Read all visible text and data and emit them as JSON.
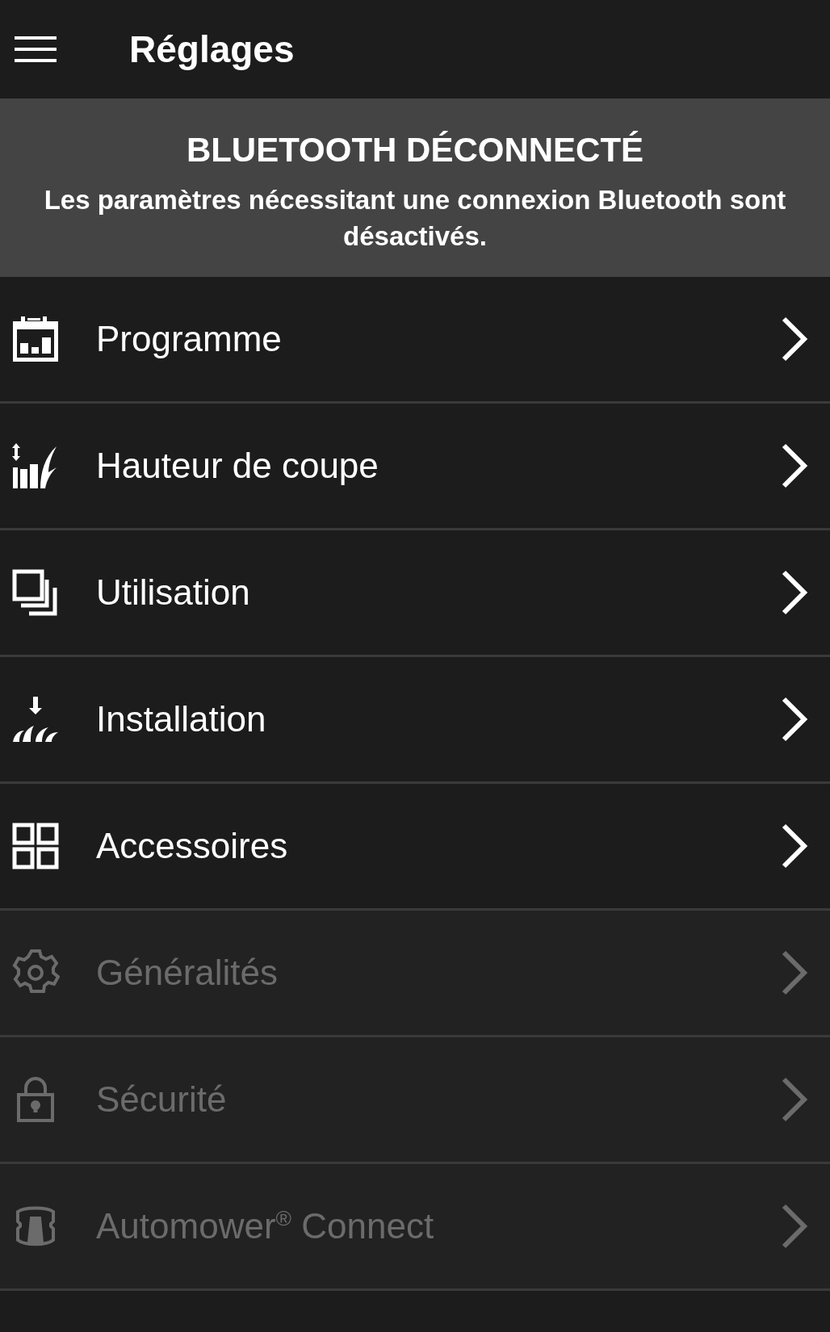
{
  "header": {
    "title": "Réglages"
  },
  "banner": {
    "title": "BLUETOOTH DÉCONNECTÉ",
    "message": "Les paramètres nécessitant une connexion Bluetooth sont désactivés."
  },
  "menu": [
    {
      "label": "Programme",
      "disabled": false
    },
    {
      "label": "Hauteur de coupe",
      "disabled": false
    },
    {
      "label": "Utilisation",
      "disabled": false
    },
    {
      "label": "Installation",
      "disabled": false
    },
    {
      "label": "Accessoires",
      "disabled": false
    },
    {
      "label": "Généralités",
      "disabled": true
    },
    {
      "label": "Sécurité",
      "disabled": true
    },
    {
      "label": "Automower$^{®}$ Connect",
      "disabled": true
    }
  ]
}
